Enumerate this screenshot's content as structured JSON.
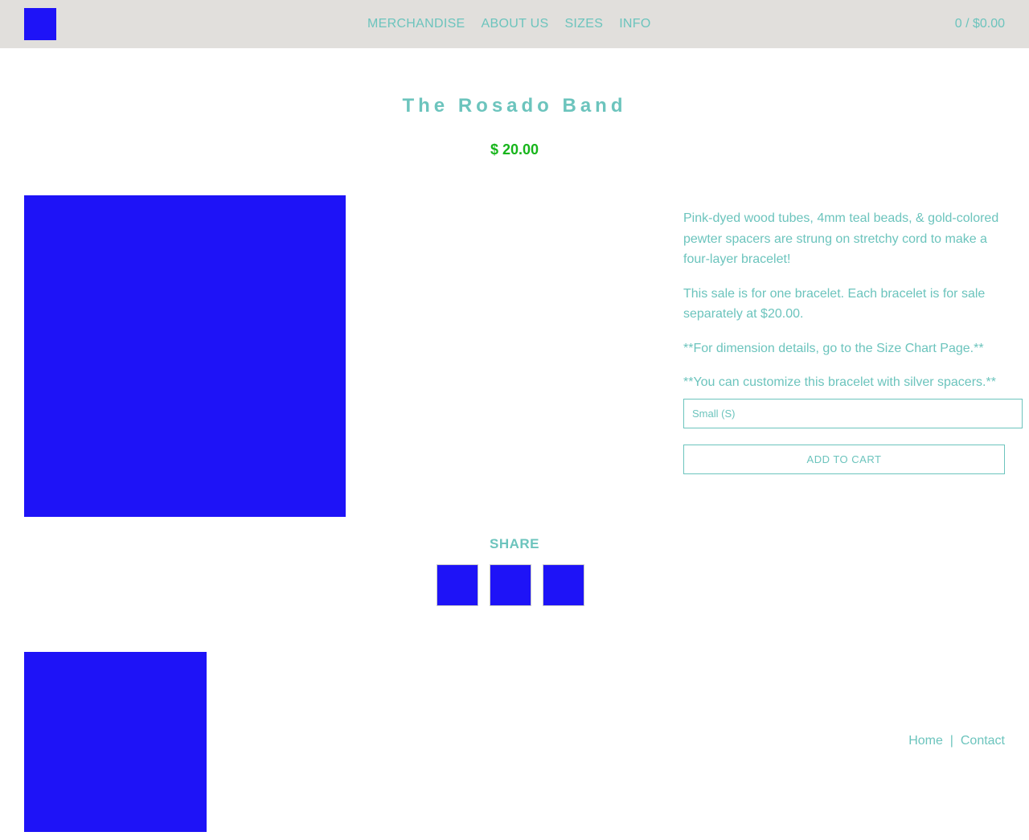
{
  "header": {
    "logo_icon": "blue-square-logo",
    "nav": [
      {
        "label": "MERCHANDISE"
      },
      {
        "label": "ABOUT US"
      },
      {
        "label": "SIZES"
      },
      {
        "label": "INFO"
      }
    ],
    "cart_label": "0 / $0.00"
  },
  "product": {
    "title": "The Rosado Band",
    "price": "$ 20.00",
    "description": [
      "Pink-dyed wood tubes, 4mm teal beads, & gold-colored pewter spacers are strung on stretchy cord to make a four-layer bracelet!",
      "This sale is for one bracelet. Each bracelet is for sale separately at $20.00.",
      "**For dimension details, go to the Size Chart Page.**",
      "**You can customize this bracelet with silver spacers.**"
    ],
    "size_selected": "Small (S)",
    "add_to_cart_label": "ADD TO CART"
  },
  "share": {
    "label": "SHARE",
    "icons": [
      "share-icon-1",
      "share-icon-2",
      "share-icon-3"
    ]
  },
  "footer": {
    "home_label": "Home",
    "separator": "|",
    "contact_label": "Contact"
  },
  "colors": {
    "accent": "#6cc4bd",
    "price": "#17b51b",
    "placeholder_blue": "#1e13f7",
    "header_bg": "#e1dfdc"
  }
}
